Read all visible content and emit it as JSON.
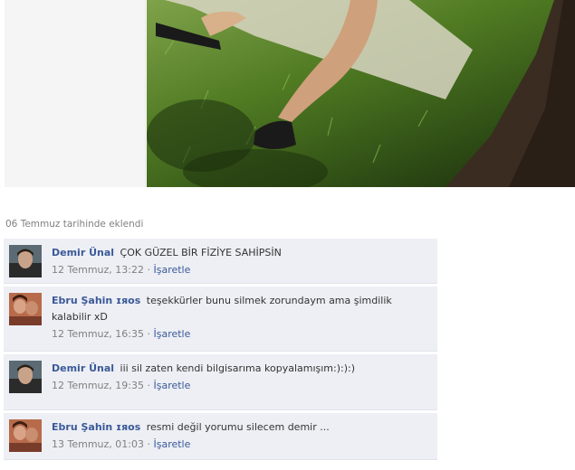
{
  "photo": {
    "alt_name": "feet-on-grass-photo"
  },
  "caption": "06 Temmuz tarihinde eklendi",
  "comments": [
    {
      "author": "Demir Ünal",
      "text": "ÇOK GÜZEL BİR FİZİYE SAHİPSİN",
      "date": "12 Temmuz, 13:22",
      "separator": "·",
      "action": "İşaretle",
      "avatar": "male-profile-avatar"
    },
    {
      "author": "Ebru Şahin ɪяᴏѕ",
      "text": "teşekkürler bunu silmek zorundaym ama şimdilik kalabilir xD",
      "date": "12 Temmuz, 16:35",
      "separator": "·",
      "action": "İşaretle",
      "avatar": "female-couple-avatar"
    },
    {
      "author": "Demir Ünal",
      "text": "iii sil zaten kendi bilgisarıma kopyalamışım:):):)",
      "date": "12 Temmuz, 19:35",
      "separator": "·",
      "action": "İşaretle",
      "avatar": "male-profile-avatar"
    },
    {
      "author": "Ebru Şahin ɪяᴏѕ",
      "text": "resmi değil yorumu silecem demir ...",
      "date": "13 Temmuz, 01:03",
      "separator": "·",
      "action": "İşaretle",
      "avatar": "female-couple-avatar"
    }
  ]
}
